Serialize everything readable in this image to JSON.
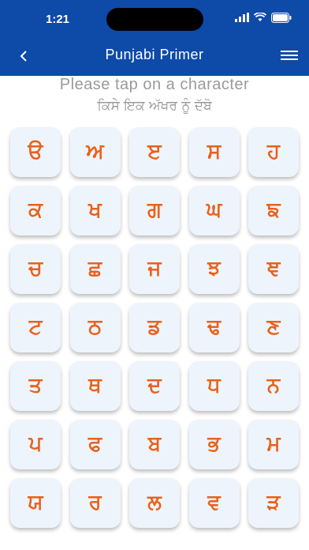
{
  "status": {
    "time": "1:21"
  },
  "nav": {
    "title": "Punjabi Primer"
  },
  "instructions": {
    "english": "Please tap on a character",
    "punjabi": "ਕਿਸੇ ਇਕ ਅੱਖਰ ਨੂੰ ਦੱਬੋ"
  },
  "characters": [
    "ੳ",
    "ਅ",
    "ੲ",
    "ਸ",
    "ਹ",
    "ਕ",
    "ਖ",
    "ਗ",
    "ਘ",
    "ਙ",
    "ਚ",
    "ਛ",
    "ਜ",
    "ਝ",
    "ਞ",
    "ਟ",
    "ਠ",
    "ਡ",
    "ਢ",
    "ਣ",
    "ਤ",
    "ਥ",
    "ਦ",
    "ਧ",
    "ਨ",
    "ਪ",
    "ਫ",
    "ਬ",
    "ਭ",
    "ਮ",
    "ਯ",
    "ਰ",
    "ਲ",
    "ਵ",
    "ੜ"
  ],
  "colors": {
    "nav_bg": "#0e4aa8",
    "accent": "#e8621c",
    "tile_bg": "#eef4fb",
    "instruction_text": "#9a9a9a"
  },
  "icons": {
    "back": "chevron-left-icon",
    "menu": "hamburger-menu-icon",
    "signal": "signal-icon",
    "wifi": "wifi-icon",
    "battery": "battery-icon"
  }
}
